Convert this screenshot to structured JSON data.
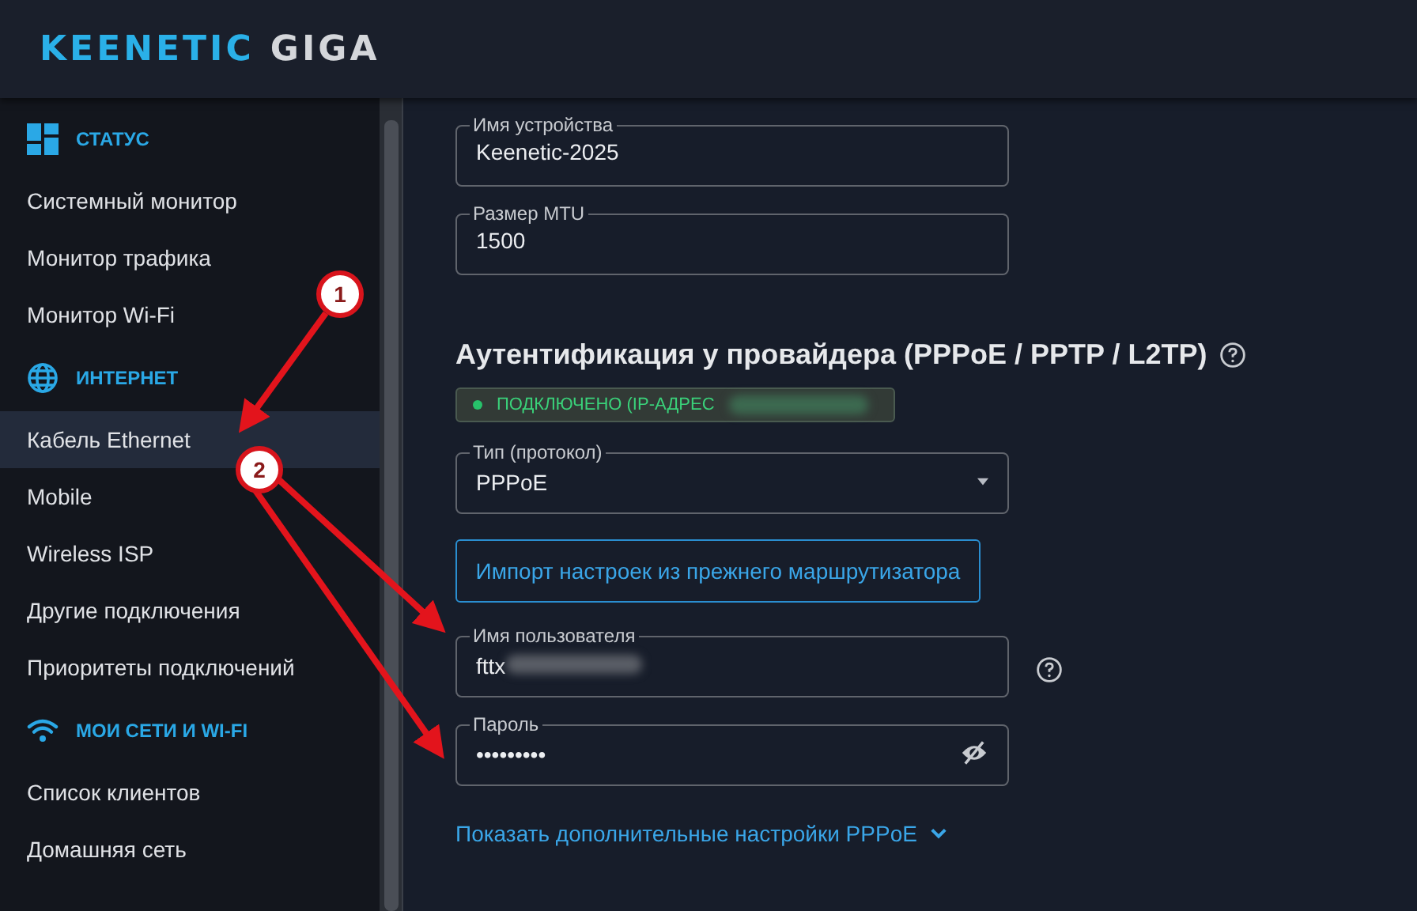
{
  "logo": {
    "brand": "KEENETIC",
    "model": "GIGA"
  },
  "sidebar": {
    "sections": [
      {
        "title": "СТАТУС",
        "items": [
          {
            "label": "Системный монитор",
            "selected": false
          },
          {
            "label": "Монитор трафика",
            "selected": false
          },
          {
            "label": "Монитор Wi-Fi",
            "selected": false
          }
        ]
      },
      {
        "title": "ИНТЕРНЕТ",
        "items": [
          {
            "label": "Кабель Ethernet",
            "selected": true
          },
          {
            "label": "Mobile",
            "selected": false
          },
          {
            "label": "Wireless ISP",
            "selected": false
          },
          {
            "label": "Другие подключения",
            "selected": false
          },
          {
            "label": "Приоритеты подключений",
            "selected": false
          }
        ]
      },
      {
        "title": "МОИ СЕТИ И WI-FI",
        "items": [
          {
            "label": "Список клиентов",
            "selected": false
          },
          {
            "label": "Домашняя сеть",
            "selected": false
          }
        ]
      }
    ]
  },
  "main": {
    "fields": [
      {
        "kind": "text",
        "label": "Имя устройства",
        "value": "Keenetic-2025"
      },
      {
        "kind": "text",
        "label": "Размер MTU",
        "value": "1500"
      }
    ],
    "section_title": "Аутентификация у провайдера (PPPoE / PPTP / L2TP)",
    "status": {
      "text": "ПОДКЛЮЧЕНО (IP-АДРЕС",
      "blurred": true
    },
    "auth_fields": [
      {
        "kind": "select",
        "label": "Тип (протокол)",
        "value": "PPPoE"
      },
      {
        "kind": "button",
        "label": "Импорт настроек из прежнего маршрутизатора"
      },
      {
        "kind": "text",
        "label": "Имя пользователя",
        "value": "fttx",
        "blurred": true,
        "help": true
      },
      {
        "kind": "password",
        "label": "Пароль",
        "value": "•••••••••"
      }
    ],
    "more_link": "Показать дополнительные настройки PPPoE"
  },
  "annotations": [
    {
      "number": "1"
    },
    {
      "number": "2"
    }
  ]
}
